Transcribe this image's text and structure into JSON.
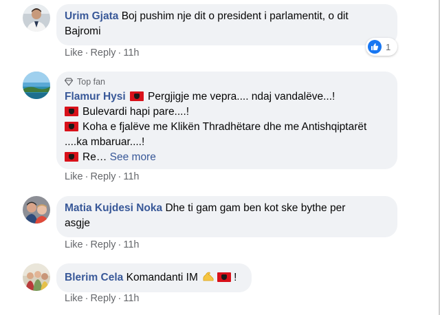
{
  "comments": [
    {
      "author": "Urim Gjata",
      "text_line1": "Boj pushim nje dit o president i parlamentit, o dit",
      "text_line2": "Bajromi",
      "actions": {
        "like": "Like",
        "reply": "Reply",
        "time": "11h"
      },
      "reactions": {
        "count": "1",
        "type": "like-icon"
      }
    },
    {
      "badge": "Top fan",
      "author": "Flamur Hysi",
      "line1": "Pergjigje me vepra.... ndaj vandalëve...!",
      "line2": "Bulevardi hapi pare....!",
      "line3": "Koha e fjalëve me Klikën Thradhëtare dhe me Antishqiptarët",
      "line4": "....ka mbaruar....!",
      "line5": "Re…",
      "see_more": "See more",
      "actions": {
        "like": "Like",
        "reply": "Reply",
        "time": "11h"
      }
    },
    {
      "author": "Matia Kujdesi Noka",
      "text_line1": "Dhe ti gam gam ben kot ske bythe per",
      "text_line2": "asgje",
      "actions": {
        "like": "Like",
        "reply": "Reply",
        "time": "11h"
      }
    },
    {
      "author": "Blerim Cela",
      "text": "Komandanti IM",
      "text_end": "!",
      "actions": {
        "like": "Like",
        "reply": "Reply",
        "time": "11h"
      }
    }
  ],
  "colors": {
    "author": "#385898",
    "bubble": "#f0f2f5",
    "meta": "#65676b",
    "like_blue": "#1877f2",
    "flag_red": "#d8111a"
  }
}
